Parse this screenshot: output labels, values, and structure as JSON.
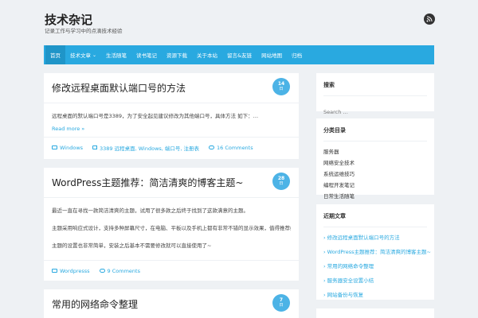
{
  "header": {
    "site_title": "技术杂记",
    "site_description": "记录工作与学习中的点滴技术经验"
  },
  "icons": {
    "rss": "rss-icon",
    "folder": "folder-icon",
    "tag": "tag-icon",
    "comment": "comment-icon"
  },
  "colors": {
    "accent": "#29a9e0",
    "badge": "#4cb3e6",
    "background": "#eef1f4"
  },
  "nav": {
    "items": [
      "首页",
      "技术文章",
      "生活随笔",
      "读书笔记",
      "资源下载",
      "关于本站",
      "留言&友链",
      "网站地图",
      "归档"
    ]
  },
  "posts": [
    {
      "title": "修改远程桌面默认端口号的方法",
      "day": "14",
      "month": "日",
      "excerpt": "远程桌面的默认端口号是3389，为了安全起见建议修改为其他端口号，具体方法 如下：…",
      "read_more": "Read more »",
      "category": "Windows",
      "tags": "3389 远程桌面, Windows, 端口号, 注册表",
      "comments": "16 Comments"
    },
    {
      "title": "WordPress主题推荐：简洁清爽的博客主题~",
      "day": "28",
      "month": "日",
      "paragraphs": [
        "最近一直在寻找一款简洁清爽的主题，试用了很多款之后终于找到了这款满意的主题。",
        "主题采用响应式设计，支持多种屏幕尺寸，在电脑、平板以及手机上都有非常不错的显示效果，值得推荐给大家。",
        "主题的设置也非常简单，安装之后基本不需要修改就可以直接使用了~"
      ],
      "category": "Wordpresss",
      "comments": "9 Comments"
    },
    {
      "title": "常用的网络命令整理",
      "day": "7",
      "month": "日"
    }
  ],
  "sidebar": {
    "search": {
      "title": "搜索",
      "placeholder": "Search …"
    },
    "categories": {
      "title": "分类目录",
      "items": [
        "服务器",
        "网络安全技术",
        "系统运维技巧",
        "编程开发笔记",
        "日常生活随笔"
      ]
    },
    "recent": {
      "title": "近期文章",
      "items": [
        "修改远程桌面默认端口号的方法",
        "WordPress主题推荐：简洁清爽的博客主题~",
        "常用的网络命令整理",
        "服务器安全设置小结",
        "网站备份与恢复"
      ]
    }
  }
}
